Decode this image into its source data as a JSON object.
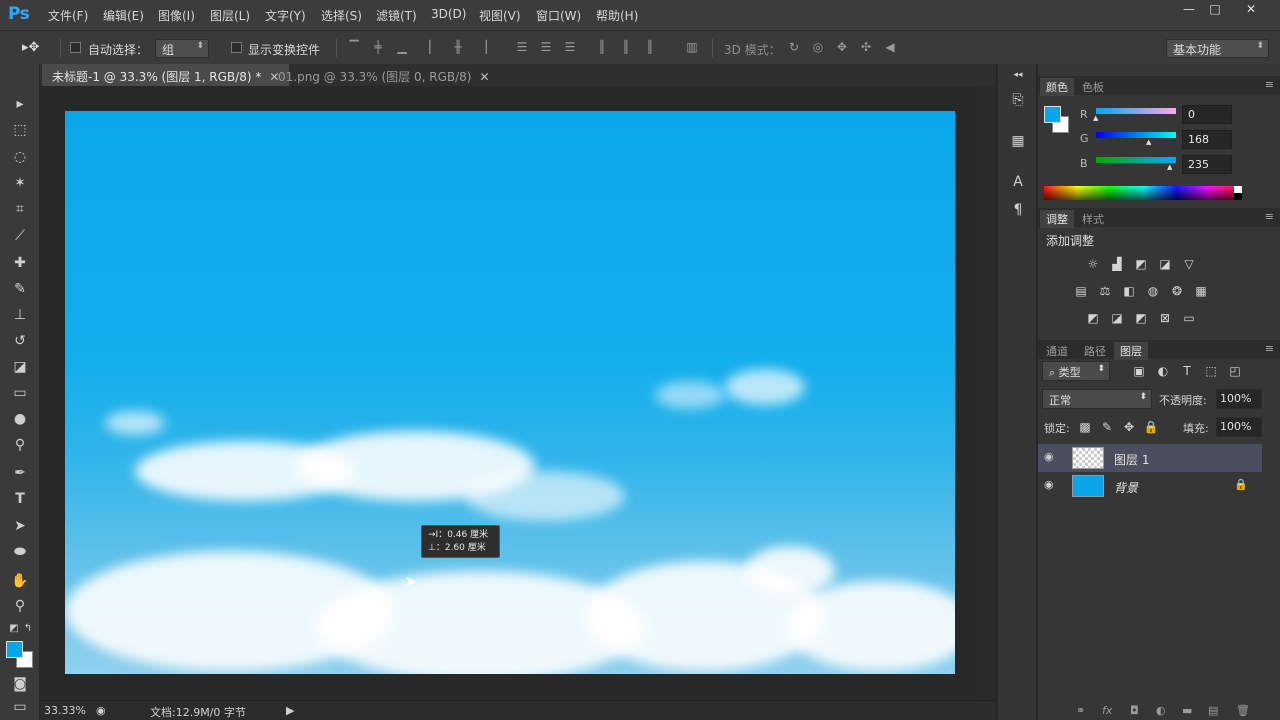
{
  "app": {
    "logo": "Ps"
  },
  "menu": [
    "文件(F)",
    "编辑(E)",
    "图像(I)",
    "图层(L)",
    "文字(Y)",
    "选择(S)",
    "滤镜(T)",
    "3D(D)",
    "视图(V)",
    "窗口(W)",
    "帮助(H)"
  ],
  "window_controls": {
    "minimize": "—",
    "maximize": "□",
    "close": "✕"
  },
  "options": {
    "auto_select_label": "自动选择：",
    "auto_select_value": "组",
    "show_transform_label": "显示变换控件",
    "mode_3d_label": "3D 模式：",
    "workspace": "基本功能"
  },
  "doc_tabs": [
    {
      "title": "未标题-1 @ 33.3% (图层 1, RGB/8) *",
      "active": true
    },
    {
      "title": "01.png @ 33.3% (图层 0, RGB/8)",
      "active": false
    }
  ],
  "tooltip": {
    "line1": "→I：0.46 厘米",
    "line2": "⊥：2.60 厘米"
  },
  "status": {
    "zoom": "33.33%",
    "doc_info": "文档:12.9M/0 字节"
  },
  "color_panel": {
    "tabs": [
      "颜色",
      "色板"
    ],
    "channels": [
      {
        "name": "R",
        "value": "0"
      },
      {
        "name": "G",
        "value": "168"
      },
      {
        "name": "B",
        "value": "235"
      }
    ],
    "foreground": "#00a8eb",
    "background": "#ffffff"
  },
  "adjustments_panel": {
    "tabs": [
      "调整",
      "样式"
    ],
    "title": "添加调整"
  },
  "layers_panel": {
    "tabs": [
      "通道",
      "路径",
      "图层"
    ],
    "filter_kind": "类型",
    "blend_mode": "正常",
    "opacity_label": "不透明度:",
    "opacity": "100%",
    "lock_label": "锁定:",
    "fill_label": "填充:",
    "fill": "100%",
    "layers": [
      {
        "name": "图层 1",
        "selected": true,
        "locked": false
      },
      {
        "name": "背景",
        "selected": false,
        "locked": true
      }
    ]
  }
}
